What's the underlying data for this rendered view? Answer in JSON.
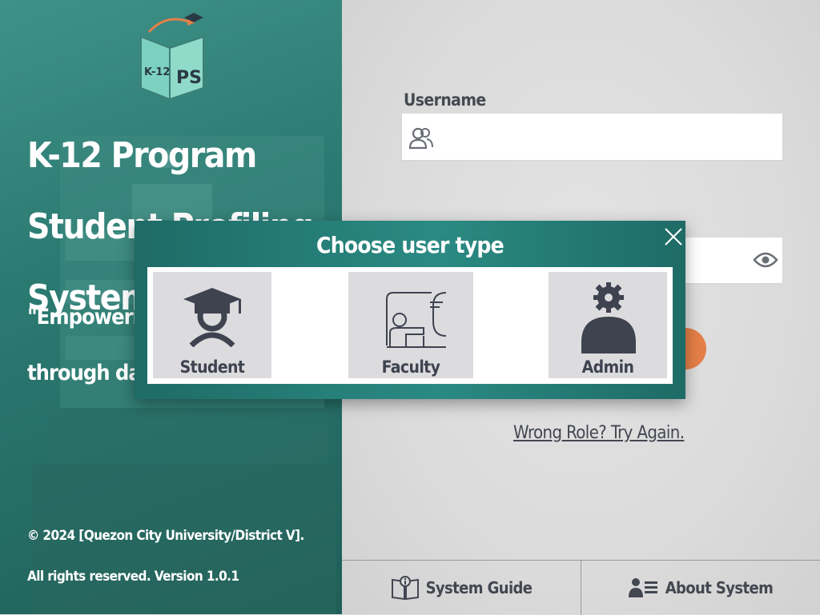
{
  "app": {
    "logo_text_left": "K-12",
    "logo_text_right": "PS",
    "title": "K-12 Program Student Profiling System",
    "tagline": "\"Empowering education through data",
    "copyright": "© 2024 [Quezon City University/District V].",
    "rights": "All rights reserved. Version 1.0.1"
  },
  "login": {
    "username_label": "Username",
    "username_value": "",
    "password_value": "",
    "wrong_role_link": "Wrong Role? Try Again."
  },
  "footer": {
    "guide_label": "System Guide",
    "about_label": "About System"
  },
  "modal": {
    "title": "Choose user type",
    "roles": [
      {
        "label": "Student",
        "icon": "student-icon"
      },
      {
        "label": "Faculty",
        "icon": "faculty-icon"
      },
      {
        "label": "Admin",
        "icon": "admin-icon"
      }
    ]
  },
  "colors": {
    "teal": "#2a8a83",
    "accent_orange": "#e57f48",
    "text_dark": "#424750"
  }
}
